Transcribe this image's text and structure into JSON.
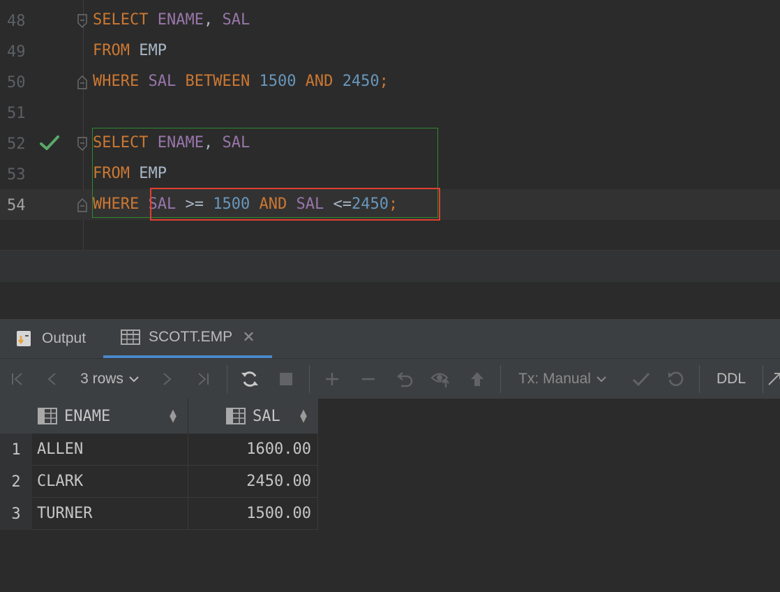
{
  "editor": {
    "lines": [
      {
        "num": "48"
      },
      {
        "num": "49"
      },
      {
        "num": "50"
      },
      {
        "num": "51"
      },
      {
        "num": "52"
      },
      {
        "num": "53"
      },
      {
        "num": "54"
      }
    ],
    "tokens": {
      "select": "SELECT",
      "ename": "ENAME",
      "comma": ",",
      "sal": "SAL",
      "from": "FROM",
      "emp": "EMP",
      "where": "WHERE",
      "between": "BETWEEN",
      "n1500": "1500",
      "and": "AND",
      "n2450": "2450",
      "semi": ";",
      "gte": ">=",
      "lte": "<="
    }
  },
  "tabs": [
    {
      "label": "Output"
    },
    {
      "label": "SCOTT.EMP"
    }
  ],
  "toolbar": {
    "rows_label": "3 rows",
    "tx_label": "Tx: Manual",
    "ddl_label": "DDL"
  },
  "grid": {
    "columns": [
      "ENAME",
      "SAL"
    ],
    "rows": [
      {
        "n": "1",
        "ename": "ALLEN",
        "sal": "1600.00"
      },
      {
        "n": "2",
        "ename": "CLARK",
        "sal": "2450.00"
      },
      {
        "n": "3",
        "ename": "TURNER",
        "sal": "1500.00"
      }
    ]
  },
  "colors": {
    "keyword": "#cc7832",
    "identifier": "#9876aa",
    "number": "#6897bb",
    "highlight_box": "#e0402e",
    "statement_box": "#2e8b2e",
    "tab_underline": "#4a88c7"
  }
}
